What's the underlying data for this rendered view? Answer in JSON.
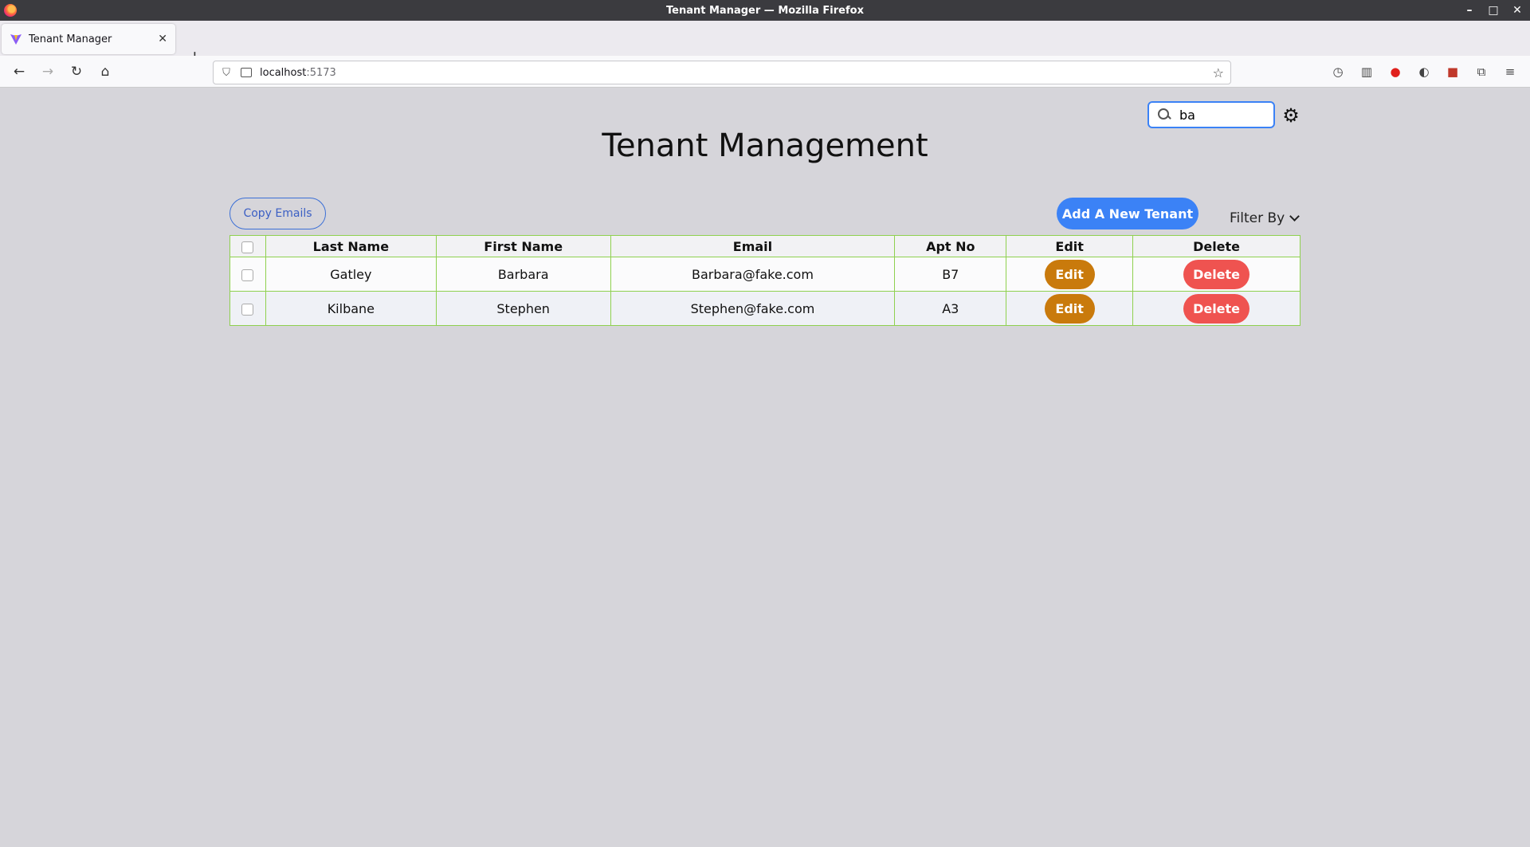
{
  "window": {
    "title": "Tenant Manager — Mozilla Firefox",
    "controls": [
      "–",
      "□",
      "✕"
    ]
  },
  "browser": {
    "tab": {
      "label": "Tenant Manager",
      "close": "✕"
    },
    "new_tab": "+",
    "url_host": "localhost",
    "url_port": ":5173",
    "icons": [
      "back-icon",
      "forward-icon",
      "reload-icon",
      "home-icon",
      "history-icon",
      "reader-view-icon",
      "extension-icon",
      "account-icon",
      "extension-icon",
      "extensions-puzzle-icon",
      "menu-icon"
    ]
  },
  "page": {
    "title": "Tenant Management",
    "search": {
      "value": "ba",
      "placeholder": ""
    },
    "copy_emails_label": "Copy Emails",
    "add_tenant_label": "Add A New Tenant",
    "filter_label": "Filter By",
    "colors": {
      "primary": "#3b82f6",
      "edit": "#c97a0c",
      "delete": "#ef5350",
      "table_border": "#8fd14f"
    }
  },
  "table": {
    "headers": [
      "Last Name",
      "First Name",
      "Email",
      "Apt No",
      "Edit",
      "Delete"
    ],
    "rows": [
      {
        "last": "Gatley",
        "first": "Barbara",
        "email": "Barbara@fake.com",
        "apt": "B7",
        "edit": "Edit",
        "delete": "Delete"
      },
      {
        "last": "Kilbane",
        "first": "Stephen",
        "email": "Stephen@fake.com",
        "apt": "A3",
        "edit": "Edit",
        "delete": "Delete"
      }
    ]
  }
}
